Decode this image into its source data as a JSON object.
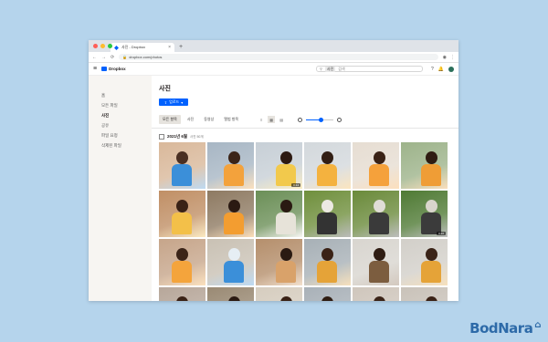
{
  "browser": {
    "tab_title": "사진 - Dropbox",
    "tab_close": "×",
    "new_tab": "+",
    "url": "dropbox.com/photos",
    "traffic_lights": [
      "#ff5f57",
      "#febc2e",
      "#28c840"
    ]
  },
  "app": {
    "logo": "Dropbox",
    "brand_color": "#0061fe",
    "search": {
      "filter_chip": "사진",
      "placeholder": "검색"
    }
  },
  "sidebar": {
    "items": [
      {
        "label": "홈",
        "active": false
      },
      {
        "label": "모든 파일",
        "active": false
      },
      {
        "label": "사진",
        "active": true
      },
      {
        "label": "공유",
        "active": false
      },
      {
        "label": "파일 요청",
        "active": false
      },
      {
        "label": "삭제된 파일",
        "active": false
      }
    ]
  },
  "main": {
    "title": "사진",
    "upload_label": "업로드",
    "filters": [
      "모든 항목",
      "사진",
      "동영상",
      "앨범 항목"
    ],
    "active_filter": 0,
    "view_options": [
      "≡",
      "▦",
      "▤"
    ],
    "active_view": 1,
    "zoom_level": 0.55,
    "date_heading": "2021년 6월",
    "date_count": "사진 50개"
  },
  "photos": [
    {
      "name": "photo-boy-painting",
      "bg": "#d9b89a",
      "fig": "#4a2f22",
      "acc": "#3b8fd9",
      "badge": ""
    },
    {
      "name": "photo-boy-couch",
      "bg": "#a7b6c4",
      "fig": "#3b2418",
      "acc": "#f3a23c",
      "badge": ""
    },
    {
      "name": "photo-boy-bench-1",
      "bg": "#c7cfd6",
      "fig": "#2d1a12",
      "acc": "#f2c94c",
      "badge": "0:14"
    },
    {
      "name": "photo-boy-bench-2",
      "bg": "#d3d8dc",
      "fig": "#321e14",
      "acc": "#f4b23f",
      "badge": ""
    },
    {
      "name": "photo-boy-smile",
      "bg": "#e6ddd2",
      "fig": "#3a2216",
      "acc": "#f5a13b",
      "badge": ""
    },
    {
      "name": "photo-boy-porch",
      "bg": "#9db38a",
      "fig": "#2f1c12",
      "acc": "#ef9d36",
      "badge": ""
    },
    {
      "name": "photo-kid-reading",
      "bg": "#c08f65",
      "fig": "#3a2216",
      "acc": "#f3c049",
      "badge": ""
    },
    {
      "name": "photo-kid-building",
      "bg": "#8e7a62",
      "fig": "#2b1a12",
      "acc": "#f39d30",
      "badge": ""
    },
    {
      "name": "photo-kid-plants",
      "bg": "#6b8f57",
      "fig": "#2a1a12",
      "acc": "#e7e3d9",
      "badge": ""
    },
    {
      "name": "photo-dog-grass-1",
      "bg": "#6f8f3c",
      "fig": "#ece9e2",
      "acc": "#333333",
      "badge": ""
    },
    {
      "name": "photo-dog-grass-2",
      "bg": "#6a8a3a",
      "fig": "#e0ddd6",
      "acc": "#3a3a3a",
      "badge": ""
    },
    {
      "name": "photo-dog-portrait",
      "bg": "#4f7a34",
      "fig": "#d9d5cc",
      "acc": "#3b3b3b",
      "badge": "0:10"
    },
    {
      "name": "photo-kid-table",
      "bg": "#c6a58a",
      "fig": "#3b2418",
      "acc": "#f4a43c",
      "badge": ""
    },
    {
      "name": "photo-artwork",
      "bg": "#c9c1b4",
      "fig": "#e6eef4",
      "acc": "#3b8fd9",
      "badge": ""
    },
    {
      "name": "photo-hair-braids",
      "bg": "#b58f6c",
      "fig": "#2a1a12",
      "acc": "#d9a26a",
      "badge": ""
    },
    {
      "name": "photo-dad-son-1",
      "bg": "#a7b0b6",
      "fig": "#3a2216",
      "acc": "#e5a338",
      "badge": ""
    },
    {
      "name": "photo-family-window",
      "bg": "#d8d5cf",
      "fig": "#2f1d13",
      "acc": "#7c5d3f",
      "badge": ""
    },
    {
      "name": "photo-dad-son-2",
      "bg": "#d2cfc9",
      "fig": "#3b2418",
      "acc": "#e5a338",
      "badge": ""
    },
    {
      "name": "photo-row4-1",
      "bg": "#b7a79a",
      "fig": "#3a2216",
      "acc": "#d9c7b4",
      "badge": ""
    },
    {
      "name": "photo-row4-2",
      "bg": "#9a8a74",
      "fig": "#2b1a12",
      "acc": "#c7b59c",
      "badge": ""
    },
    {
      "name": "photo-row4-3",
      "bg": "#d6cdbf",
      "fig": "#3a2216",
      "acc": "#e5a338",
      "badge": ""
    },
    {
      "name": "photo-row4-4",
      "bg": "#a9b1b8",
      "fig": "#2f1d13",
      "acc": "#e2a73d",
      "badge": ""
    },
    {
      "name": "photo-row4-5",
      "bg": "#cfc6bc",
      "fig": "#3b2418",
      "acc": "#f2b247",
      "badge": ""
    },
    {
      "name": "photo-row4-6",
      "bg": "#c9c2b9",
      "fig": "#3a2216",
      "acc": "#e8a53c",
      "badge": ""
    }
  ],
  "watermark": "BodNara"
}
